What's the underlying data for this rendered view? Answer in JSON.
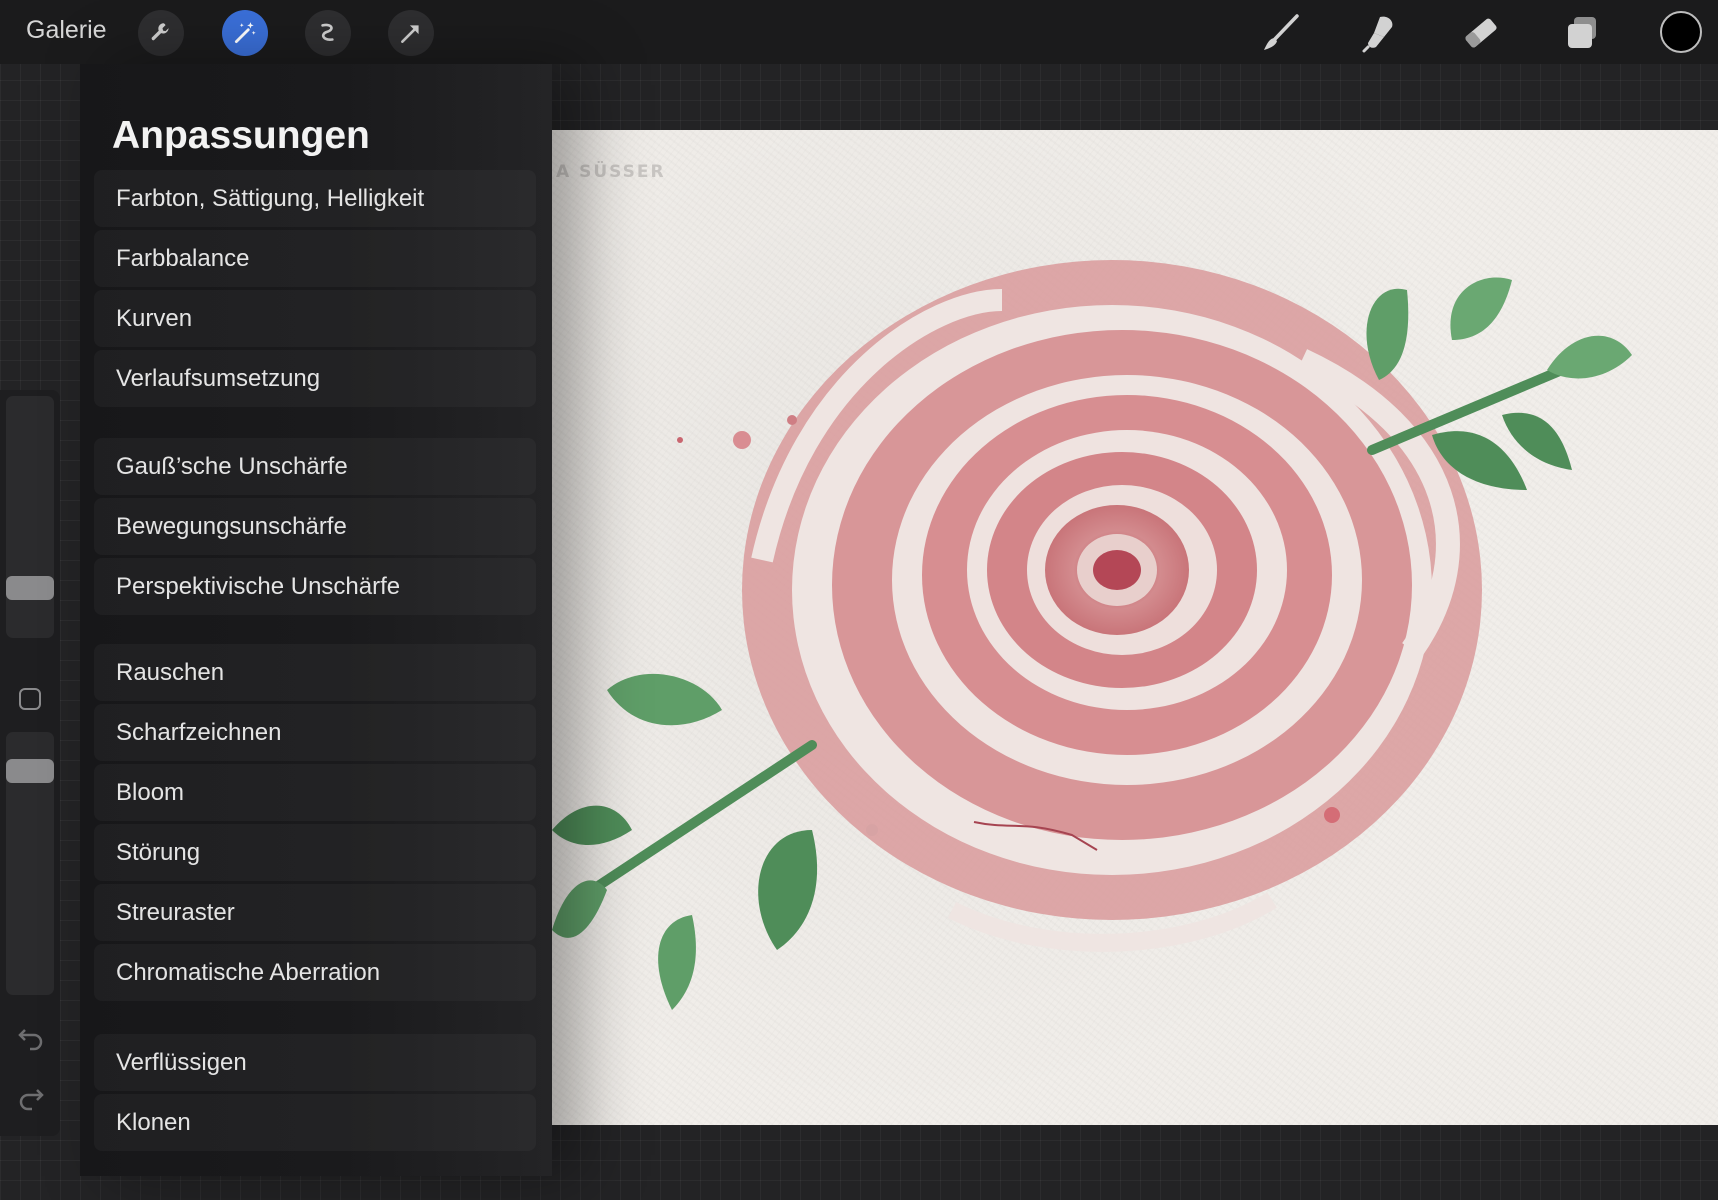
{
  "toolbar": {
    "gallery_label": "Galerie",
    "left_tools": [
      "wrench-icon",
      "magic-wand-icon",
      "selection-icon",
      "transform-arrow-icon"
    ],
    "active_tool": "magic-wand-icon",
    "right_tools": [
      "brush-icon",
      "smudge-icon",
      "eraser-icon",
      "layers-icon"
    ],
    "current_color": "#000000",
    "accent_color": "#3a6fd8"
  },
  "canvas": {
    "watermark": "A SÜSSER",
    "subject": "watercolor rose with leaves"
  },
  "sidebar": {
    "icons": [
      "brush-size-slider",
      "modify-button",
      "opacity-slider",
      "undo-icon",
      "redo-icon"
    ]
  },
  "adjustments": {
    "title": "Anpassungen",
    "groups": [
      [
        "Farbton, Sättigung, Helligkeit",
        "Farbbalance",
        "Kurven",
        "Verlaufsumsetzung"
      ],
      [
        "Gauß’sche Unschärfe",
        "Bewegungsunschärfe",
        "Perspektivische Unschärfe"
      ],
      [
        "Rauschen",
        "Scharfzeichnen",
        "Bloom",
        "Störung",
        "Streuraster",
        "Chromatische Aberration"
      ],
      [
        "Verflüssigen",
        "Klonen"
      ]
    ]
  }
}
